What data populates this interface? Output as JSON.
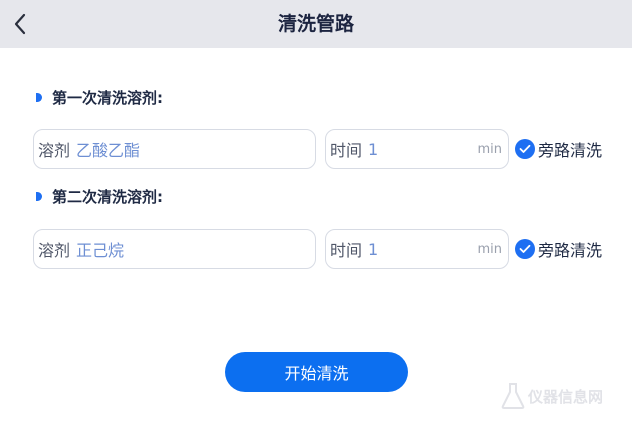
{
  "header": {
    "title": "清洗管路"
  },
  "sections": [
    {
      "title": "第一次清洗溶剂:",
      "solvent_label": "溶剂",
      "solvent_value": "乙酸乙酯",
      "time_label": "时间",
      "time_value": "1",
      "time_unit": "min",
      "bypass_label": "旁路清洗",
      "bypass_checked": true
    },
    {
      "title": "第二次清洗溶剂:",
      "solvent_label": "溶剂",
      "solvent_value": "正己烷",
      "time_label": "时间",
      "time_value": "1",
      "time_unit": "min",
      "bypass_label": "旁路清洗",
      "bypass_checked": true
    }
  ],
  "start_button": {
    "label": "开始清洗"
  },
  "watermark": {
    "text": "仪器信息网"
  },
  "colors": {
    "accent": "#0c6ff0",
    "header_bg": "#e6e7ec",
    "value_text": "#6e8fd3"
  }
}
